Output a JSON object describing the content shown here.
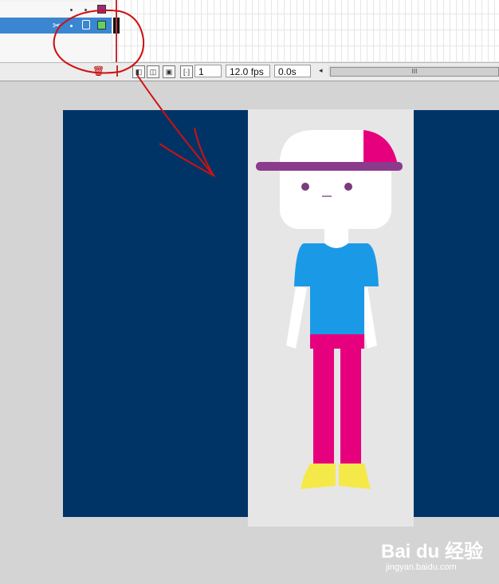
{
  "timeline": {
    "frame_number": "1",
    "frame_rate": "12.0 fps",
    "elapsed_time": "0.0s",
    "scroll_thumb_grip": "III",
    "layers": [
      {
        "selected": false,
        "color": "#a0287e"
      },
      {
        "selected": true,
        "color": "#5fd35f"
      }
    ]
  },
  "colors": {
    "stage_background": "#003466",
    "character_panel": "#e6e6e6",
    "cap_magenta": "#e6007e",
    "cap_brim": "#8b3b8b",
    "hair": "#f5e94a",
    "shirt": "#1a9ae6",
    "pants": "#e6007e",
    "shoes": "#f5e94a",
    "annotation": "#d01010"
  },
  "watermark": {
    "brand_text": "Bai du 经验",
    "url_text": "jingyan.baidu.com"
  }
}
